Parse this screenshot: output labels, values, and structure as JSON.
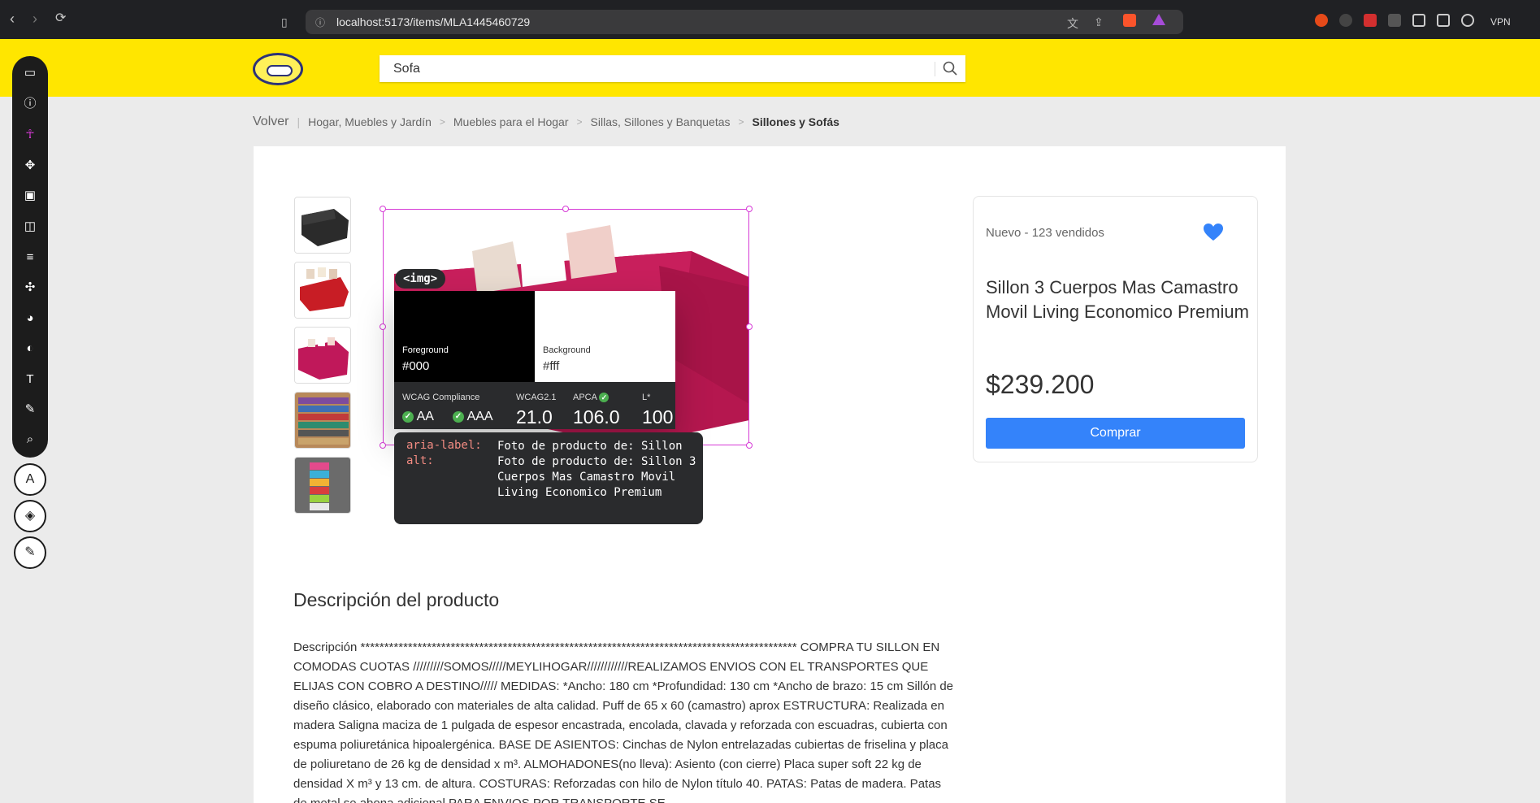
{
  "browser": {
    "url": "localhost:5173/items/MLA1445460729",
    "vpn_label": "VPN"
  },
  "header": {
    "search_value": "Sofa",
    "brand_color": "#ffe600"
  },
  "breadcrumb": {
    "back": "Volver",
    "items": [
      "Hogar, Muebles y Jardín",
      "Muebles para el Hogar",
      "Sillas, Sillones y Banquetas"
    ],
    "current": "Sillones y Sofás"
  },
  "product": {
    "condition": "Nuevo  - 123 vendidos",
    "title": "Sillon 3 Cuerpos Mas Camastro Movil Living Economico Premium",
    "price": "$239.200",
    "buy_label": "Comprar",
    "button_color": "#3483fa",
    "thumbnails": [
      "black-sofa-thumb",
      "red-sofa-thumb",
      "pink-sofa-thumb",
      "fabric-samples-thumb",
      "colors-thumb"
    ]
  },
  "inspector": {
    "tag": "<img>",
    "foreground_label": "Foreground",
    "foreground_value": "#000",
    "background_label": "Background",
    "background_value": "#fff",
    "wcag_compliance_label": "WCAG Compliance",
    "aa": "AA",
    "aaa": "AAA",
    "wcag21_label": "WCAG2.1",
    "wcag21_value": "21.0",
    "apca_label": "APCA",
    "apca_value": "106.0",
    "l_label": "L*",
    "l_value": "100",
    "aria_label_key": "aria-label:",
    "alt_key": "alt:",
    "aria_value": "Foto de producto de: Sillon",
    "alt_value": "Foto de producto de: Sillon 3 Cuerpos Mas Camastro Movil Living Economico Premium"
  },
  "description": {
    "title": "Descripción del producto",
    "body": "Descripción ******************************************************************************************** COMPRA TU SILLON EN COMODAS CUOTAS /////////SOMOS/////MEYLIHOGAR////////////REALIZAMOS ENVIOS CON EL TRANSPORTES QUE ELIJAS CON COBRO A DESTINO///// MEDIDAS: *Ancho: 180 cm *Profundidad: 130 cm *Ancho de brazo: 15 cm Sillón de diseño clásico, elaborado con materiales de alta calidad. Puff de 65 x 60 (camastro) aprox ESTRUCTURA: Realizada en madera Saligna maciza de 1 pulgada de espesor encastrada, encolada, clavada y reforzada con escuadras, cubierta con espuma poliuretánica hipoalergénica. BASE DE ASIENTOS: Cinchas de Nylon entrelazadas cubiertas de friselina y placa de poliuretano de 26 kg de densidad x m³. ALMOHADONES(no lleva): Asiento (con cierre) Placa super soft 22 kg de densidad X m³ y 13 cm. de altura. COSTURAS: Reforzadas con hilo de Nylon título 40. PATAS: Patas de madera. Patas de metal se abona adicional PARA ENVIOS POR TRANSPORTE SE"
  },
  "toolbar": {
    "tools": [
      "ruler-icon",
      "info-icon",
      "accessibility-icon",
      "move-icon",
      "margin-icon",
      "padding-icon",
      "align-icon",
      "hue-icon",
      "palette-icon",
      "contrast-icon",
      "font-icon",
      "edit-icon",
      "search-icon"
    ],
    "text_tool_label": "A"
  }
}
